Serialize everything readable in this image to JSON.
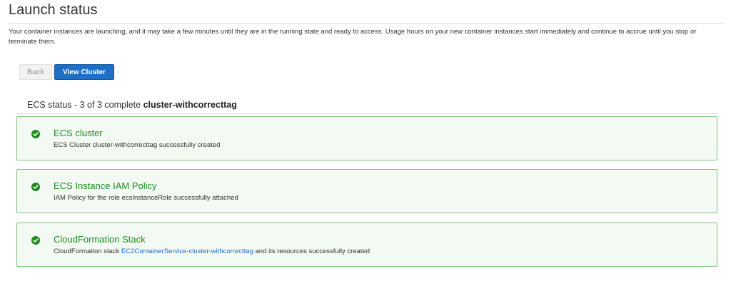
{
  "page": {
    "title": "Launch status",
    "description": "Your container instances are launching, and it may take a few minutes until they are in the running state and ready to access. Usage hours on your new container instances start immediately and continue to accrue until you stop or terminate them."
  },
  "buttons": {
    "back_label": "Back",
    "view_cluster_label": "View Cluster"
  },
  "status": {
    "prefix": "ECS status - 3 of 3 complete ",
    "cluster_name": "cluster-withcorrecttag"
  },
  "steps": [
    {
      "title": "ECS cluster",
      "text": "ECS Cluster cluster-withcorrecttag successfully created",
      "icon": "check-circle-icon"
    },
    {
      "title": "ECS Instance IAM Policy",
      "text": "IAM Policy for the role ecsInstanceRole successfully attached",
      "icon": "check-circle-icon"
    },
    {
      "title": "CloudFormation Stack",
      "text_before": "CloudFormation stack ",
      "link": "EC2ContainerService-cluster-withcorrecttag",
      "text_after": " and its resources successfully created",
      "icon": "check-circle-icon"
    }
  ],
  "colors": {
    "success": "#1d8b1d",
    "primary": "#1e6fc5",
    "card_background": "#f3faf3",
    "card_border": "#7fc07f"
  }
}
